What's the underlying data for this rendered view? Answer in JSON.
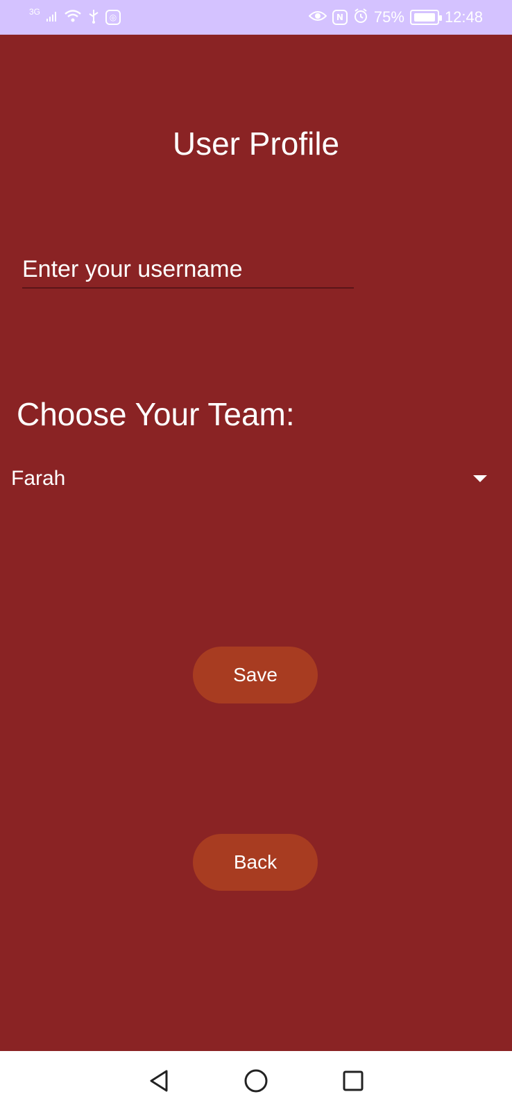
{
  "status_bar": {
    "signal_label": "3G",
    "battery_percent": "75%",
    "time": "12:48",
    "colors": {
      "background": "#d4c2ff",
      "text": "#ffffff"
    },
    "icons": [
      "signal-icon",
      "wifi-icon",
      "usb-icon",
      "instagram-icon",
      "eye-icon",
      "nfc-icon",
      "alarm-icon",
      "battery-icon"
    ]
  },
  "main": {
    "background_color": "#8a2324",
    "title": "User Profile",
    "username_placeholder": "Enter your username",
    "team_label": "Choose Your Team:",
    "team_selected": "Farah",
    "save_label": "Save",
    "back_label": "Back",
    "button_color": "#a83c21"
  },
  "nav_bar": {
    "icons": [
      "back-icon",
      "home-icon",
      "recents-icon"
    ]
  }
}
